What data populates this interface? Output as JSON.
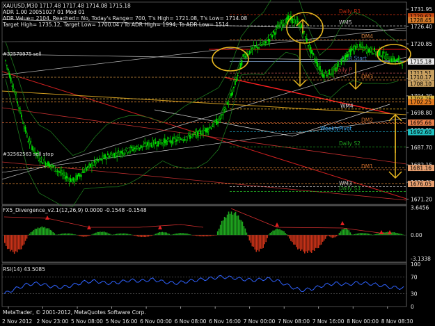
{
  "main_panel": {
    "header_lines": [
      "XAUUSD,M30  1717.48 1717.48 1714.08 1715.18",
      "ADR 1.00 20051027 01 Mod 01",
      "ADR Value= 2104, Reached= No, Today's Range= 700, T's High= 1721.08, T's Low= 1714.08",
      "Target High= 1735.12, Target Low= 1700.04 / To ADR High= 1994, To ADR Low= 1514"
    ],
    "order_labels": [
      "#32579975 sell",
      "#32562563 sell stop"
    ],
    "current_price": "1715.18"
  },
  "price_axis": {
    "ticks": [
      "1731.95",
      "1726.40",
      "1720.85",
      "1715.30",
      "1709.75",
      "1704.20",
      "1698.80",
      "1693.25",
      "1687.70",
      "1682.15",
      "1676.60",
      "1671.20"
    ],
    "tick_values": [
      1731.95,
      1726.4,
      1720.85,
      1715.3,
      1709.75,
      1704.2,
      1698.8,
      1693.25,
      1687.7,
      1682.15,
      1676.6,
      1671.2
    ],
    "ylim": [
      1669.5,
      1734.2
    ]
  },
  "levels": [
    {
      "name": "Daily R1",
      "price": 1730.2,
      "color": "#d03010",
      "tag": "Daily R1",
      "tag_color": "#c02c10",
      "axis_label": "1729.62",
      "label_bg": "#c84a14"
    },
    {
      "name": "WM5",
      "price": 1726.6,
      "color": "#c8c8c8",
      "tag": "WM5",
      "tag_color": "#cfcfcf",
      "axis_label": "1728.45",
      "label_bg": "#d47a2a"
    },
    {
      "name": "DM4",
      "price": 1722.2,
      "color": "#c86a2a",
      "tag": "DM4",
      "tag_color": "#d08040",
      "axis_label": "",
      "label_bg": ""
    },
    {
      "name": "Sell line",
      "price": 1719.1,
      "color": "#e01010",
      "tag": "",
      "tag_color": "",
      "axis_label": "",
      "label_bg": ""
    },
    {
      "name": "ADR Start",
      "price": 1715.2,
      "color": "#6a8ab0",
      "tag": "ADR Start",
      "tag_color": "#4a80c0",
      "axis_label": "1715.18",
      "label_bg": "#e8e8e8"
    },
    {
      "name": "Daily P",
      "price": 1711.5,
      "color": "#b85050",
      "tag": "Daily P",
      "tag_color": "#b84040",
      "axis_label": "1711.51",
      "label_bg": "#c8a060"
    },
    {
      "name": "Level 1710.17",
      "price": 1710.17,
      "color": "#a07030",
      "tag": "",
      "tag_color": "",
      "axis_label": "1710.17",
      "label_bg": "#c8a060"
    },
    {
      "name": "DM3",
      "price": 1709.3,
      "color": "#c86a2a",
      "tag": "DM3",
      "tag_color": "#c86a2a",
      "axis_label": "1708.10",
      "label_bg": "#c8a060"
    },
    {
      "name": "Level 1703.25",
      "price": 1703.25,
      "color": "#c8a040",
      "tag": "",
      "tag_color": "",
      "axis_label": "1703.25",
      "label_bg": "#d8b040"
    },
    {
      "name": "Level 1702.25",
      "price": 1702.25,
      "color": "#d08030",
      "tag": "",
      "tag_color": "",
      "axis_label": "1702.25",
      "label_bg": "#e07a20"
    },
    {
      "name": "WM4",
      "price": 1700.0,
      "color": "#d4a020",
      "tag": "WM4",
      "tag_color": "#d8d8d8",
      "axis_label": "",
      "label_bg": ""
    },
    {
      "name": "Level 1695.66",
      "price": 1695.66,
      "color": "#d06030",
      "tag": "",
      "tag_color": "",
      "axis_label": "1695.66",
      "label_bg": "#e8804a"
    },
    {
      "name": "DM2",
      "price": 1695.4,
      "color": "#c86a2a",
      "tag": "DM2",
      "tag_color": "#c86a2a",
      "axis_label": "",
      "label_bg": ""
    },
    {
      "name": "WeeklyPivot",
      "price": 1692.7,
      "color": "#20a0c0",
      "tag": "WeeklyPivot",
      "tag_color": "#3cb0ff",
      "axis_label": "1692.60",
      "label_bg": "#20c0c0"
    },
    {
      "name": "Daily S2",
      "price": 1687.9,
      "color": "#20a020",
      "tag": "Daily S2",
      "tag_color": "#20a020",
      "axis_label": "",
      "label_bg": ""
    },
    {
      "name": "Level 1681.16",
      "price": 1681.16,
      "color": "#d08030",
      "tag": "",
      "tag_color": "",
      "axis_label": "1681.16",
      "label_bg": "#e8a070"
    },
    {
      "name": "DM1",
      "price": 1680.6,
      "color": "#c86a2a",
      "tag": "DM1",
      "tag_color": "#c86a2a",
      "axis_label": "",
      "label_bg": ""
    },
    {
      "name": "Level 1676.05",
      "price": 1676.05,
      "color": "#d08030",
      "tag": "",
      "tag_color": "",
      "axis_label": "1676.05",
      "label_bg": "#e8a070"
    },
    {
      "name": "WM3",
      "price": 1675.2,
      "color": "#c8c8c8",
      "tag": "WM3",
      "tag_color": "#cfcfcf",
      "axis_label": "",
      "label_bg": ""
    },
    {
      "name": "Daily S3",
      "price": 1673.6,
      "color": "#20a020",
      "tag": "Daily S3",
      "tag_color": "#20a020",
      "axis_label": "",
      "label_bg": ""
    }
  ],
  "indicator_panel": {
    "title": "FX5_Divergence_v2.1(12,26,9) 0.0000 -0.1548 -0.1548",
    "ticks": [
      "3.6456",
      "0.00",
      "-3.1338"
    ],
    "tick_values": [
      3.6456,
      0,
      -3.1338
    ],
    "ylim": [
      -3.6,
      3.9
    ]
  },
  "rsi_panel": {
    "title": "RSI(14) 43.5085",
    "ticks": [
      "100",
      "70",
      "30",
      "0"
    ],
    "tick_values": [
      100,
      70,
      30,
      0
    ],
    "level_lines": [
      70,
      30
    ],
    "ylim": [
      0,
      100
    ]
  },
  "time_axis": {
    "labels": [
      "2 Nov 2012",
      "2 Nov 23:00",
      "5 Nov 08:00",
      "5 Nov 16:00",
      "6 Nov 00:00",
      "6 Nov 08:00",
      "6 Nov 16:00",
      "7 Nov 00:00",
      "7 Nov 08:00",
      "7 Nov 16:00",
      "8 Nov 00:00",
      "8 Nov 08:30"
    ]
  },
  "copyright": "MetaTrader, © 2001-2012, MetaQuotes Software Corp.",
  "chart_data": {
    "type": "candlestick",
    "symbol": "XAUUSD",
    "timeframe": "M30",
    "x": [
      "2 Nov 2012",
      "2 Nov 23:00",
      "5 Nov 08:00",
      "5 Nov 16:00",
      "6 Nov 00:00",
      "6 Nov 08:00",
      "6 Nov 16:00",
      "7 Nov 00:00",
      "7 Nov 08:00",
      "7 Nov 16:00",
      "8 Nov 00:00",
      "8 Nov 08:30"
    ],
    "close": [
      1715.5,
      1682.0,
      1680.5,
      1686.0,
      1688.0,
      1691.0,
      1694.0,
      1719.5,
      1729.0,
      1712.0,
      1720.0,
      1715.18
    ],
    "ylim": [
      1669.5,
      1734.2
    ],
    "ohlc_last": {
      "open": 1717.48,
      "high": 1717.48,
      "low": 1714.08,
      "close": 1715.18
    },
    "indicator": {
      "name": "FX5_Divergence_v2.1(12,26,9)",
      "values": [
        -2.4,
        -1.0,
        0.3,
        0.1,
        -0.2,
        0.4,
        0.2,
        3.4,
        0.5,
        -2.6,
        1.0,
        -0.15
      ]
    },
    "rsi": {
      "name": "RSI(14)",
      "values": [
        30,
        48,
        55,
        58,
        52,
        60,
        62,
        66,
        64,
        40,
        52,
        43.5085
      ]
    }
  }
}
